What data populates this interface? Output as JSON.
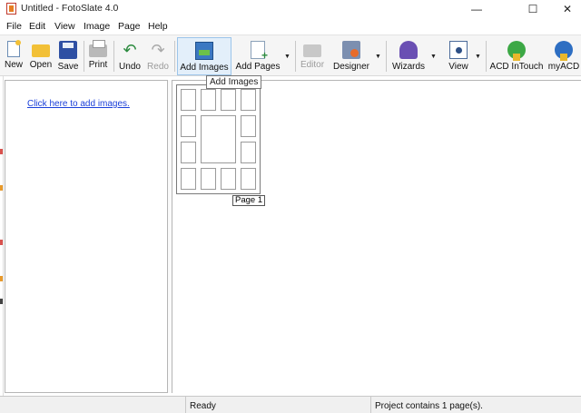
{
  "window": {
    "title": "Untitled - FotoSlate 4.0",
    "minimize": "—",
    "maximize": "☐",
    "close": "✕"
  },
  "menu": [
    "File",
    "Edit",
    "View",
    "Image",
    "Page",
    "Help"
  ],
  "toolbar": {
    "buttons": [
      {
        "label": "New",
        "icon": "new-icon"
      },
      {
        "label": "Open",
        "icon": "open-folder-icon"
      },
      {
        "label": "Save",
        "icon": "floppy-disk-icon"
      },
      {
        "label": "Print",
        "icon": "printer-icon"
      },
      {
        "label": "Undo",
        "icon": "undo-icon"
      },
      {
        "label": "Redo",
        "icon": "redo-icon"
      },
      {
        "label": "Add Images",
        "icon": "add-images-icon"
      },
      {
        "label": "Add Pages",
        "icon": "add-pages-icon"
      },
      {
        "label": "Editor",
        "icon": "editor-icon"
      },
      {
        "label": "Designer",
        "icon": "designer-icon"
      },
      {
        "label": "Wizards",
        "icon": "wizard-icon"
      },
      {
        "label": "View",
        "icon": "view-icon"
      },
      {
        "label": "ACD InTouch",
        "icon": "acd-intouch-icon"
      },
      {
        "label": "myACD",
        "icon": "myacd-icon"
      }
    ],
    "dropdown_glyph": "▼",
    "undo_glyph": "↶",
    "redo_glyph": "↷"
  },
  "tooltip": "Add Images",
  "left_pane": {
    "link": "Click here to add images."
  },
  "canvas": {
    "page_label": "Page 1"
  },
  "status": {
    "ready": "Ready",
    "project": "Project contains 1 page(s)."
  },
  "colors": {
    "link": "#1a3fd9",
    "active_button": "#e3effa",
    "toolbar_bg": "#f5f5f5"
  }
}
